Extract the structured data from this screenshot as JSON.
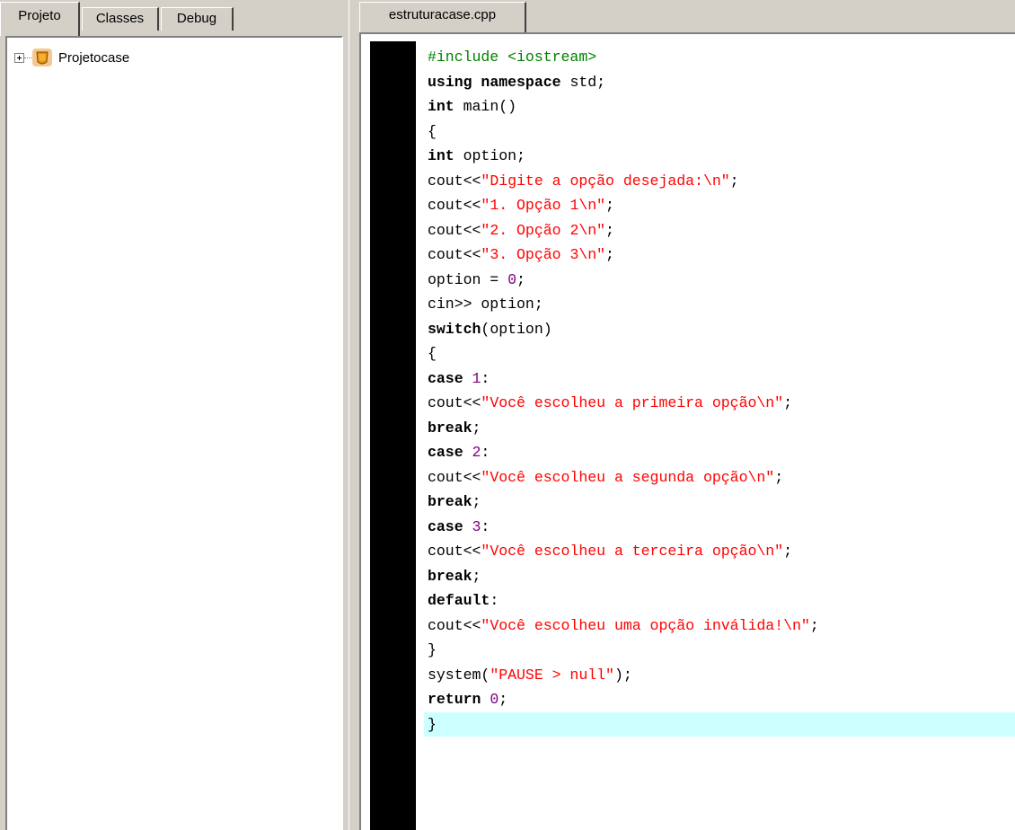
{
  "left_panel": {
    "tabs": [
      {
        "label": "Projeto",
        "active": true
      },
      {
        "label": "Classes",
        "active": false
      },
      {
        "label": "Debug",
        "active": false
      }
    ],
    "tree": {
      "root_label": "Projetocase",
      "root_icon": "project-icon",
      "expander_icon": "plus-expander-icon"
    }
  },
  "editor": {
    "tab_label": "estruturacase.cpp",
    "current_line": 25,
    "colors": {
      "keyword": "#000000",
      "string": "#ff0000",
      "number": "#800080",
      "preprocessor": "#008000",
      "current_line_bg": "#ccffff",
      "gutter": "#000000"
    },
    "lines": [
      [
        {
          "t": "#include <iostream>",
          "c": "pp"
        }
      ],
      [
        {
          "t": "using",
          "c": "kw"
        },
        {
          "t": " "
        },
        {
          "t": "namespace",
          "c": "kw"
        },
        {
          "t": " std;"
        }
      ],
      [
        {
          "t": "int",
          "c": "kw"
        },
        {
          "t": " main()"
        }
      ],
      [
        {
          "t": "{"
        }
      ],
      [
        {
          "t": "int",
          "c": "kw"
        },
        {
          "t": " option;"
        }
      ],
      [
        {
          "t": "cout<<"
        },
        {
          "t": "\"Digite a opção desejada:\\n\"",
          "c": "str"
        },
        {
          "t": ";"
        }
      ],
      [
        {
          "t": "cout<<"
        },
        {
          "t": "\"1. Opção 1\\n\"",
          "c": "str"
        },
        {
          "t": ";"
        }
      ],
      [
        {
          "t": "cout<<"
        },
        {
          "t": "\"2. Opção 2\\n\"",
          "c": "str"
        },
        {
          "t": ";"
        }
      ],
      [
        {
          "t": "cout<<"
        },
        {
          "t": "\"3. Opção 3\\n\"",
          "c": "str"
        },
        {
          "t": ";"
        }
      ],
      [
        {
          "t": "option = "
        },
        {
          "t": "0",
          "c": "num"
        },
        {
          "t": ";"
        }
      ],
      [
        {
          "t": "cin>> option;"
        }
      ],
      [
        {
          "t": "switch",
          "c": "kw"
        },
        {
          "t": "(option)"
        }
      ],
      [
        {
          "t": "{"
        }
      ],
      [
        {
          "t": "case",
          "c": "kw"
        },
        {
          "t": " "
        },
        {
          "t": "1",
          "c": "num"
        },
        {
          "t": ":"
        }
      ],
      [
        {
          "t": "cout<<"
        },
        {
          "t": "\"Você escolheu a primeira opção\\n\"",
          "c": "str"
        },
        {
          "t": ";"
        }
      ],
      [
        {
          "t": "break",
          "c": "kw"
        },
        {
          "t": ";"
        }
      ],
      [
        {
          "t": "case",
          "c": "kw"
        },
        {
          "t": " "
        },
        {
          "t": "2",
          "c": "num"
        },
        {
          "t": ":"
        }
      ],
      [
        {
          "t": "cout<<"
        },
        {
          "t": "\"Você escolheu a segunda opção\\n\"",
          "c": "str"
        },
        {
          "t": ";"
        }
      ],
      [
        {
          "t": "break",
          "c": "kw"
        },
        {
          "t": ";"
        }
      ],
      [
        {
          "t": "case",
          "c": "kw"
        },
        {
          "t": " "
        },
        {
          "t": "3",
          "c": "num"
        },
        {
          "t": ":"
        }
      ],
      [
        {
          "t": "cout<<"
        },
        {
          "t": "\"Você escolheu a terceira opção\\n\"",
          "c": "str"
        },
        {
          "t": ";"
        }
      ],
      [
        {
          "t": "break",
          "c": "kw"
        },
        {
          "t": ";"
        }
      ],
      [
        {
          "t": "default",
          "c": "kw"
        },
        {
          "t": ":"
        }
      ],
      [
        {
          "t": "cout<<"
        },
        {
          "t": "\"Você escolheu uma opção inválida!\\n\"",
          "c": "str"
        },
        {
          "t": ";"
        }
      ],
      [
        {
          "t": "}"
        }
      ],
      [
        {
          "t": "system("
        },
        {
          "t": "\"PAUSE > null\"",
          "c": "str"
        },
        {
          "t": ");"
        }
      ],
      [
        {
          "t": "return",
          "c": "kw"
        },
        {
          "t": " "
        },
        {
          "t": "0",
          "c": "num"
        },
        {
          "t": ";"
        }
      ],
      [
        {
          "t": "}"
        }
      ]
    ]
  }
}
